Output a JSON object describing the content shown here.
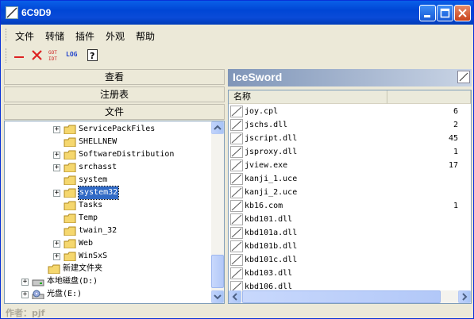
{
  "window": {
    "title": "6C9D9"
  },
  "menu": [
    "文件",
    "转储",
    "插件",
    "外观",
    "帮助"
  ],
  "toolbar": {
    "log_label": "LOG"
  },
  "nav": {
    "view": "查看",
    "registry": "注册表",
    "files": "文件"
  },
  "tree": {
    "items": [
      {
        "label": "ServicePackFiles",
        "expander": "+"
      },
      {
        "label": "SHELLNEW",
        "expander": ""
      },
      {
        "label": "SoftwareDistribution",
        "expander": "+"
      },
      {
        "label": "srchasst",
        "expander": "+"
      },
      {
        "label": "system",
        "expander": ""
      },
      {
        "label": "system32",
        "expander": "+",
        "selected": true
      },
      {
        "label": "Tasks",
        "expander": ""
      },
      {
        "label": "Temp",
        "expander": ""
      },
      {
        "label": "twain_32",
        "expander": ""
      },
      {
        "label": "Web",
        "expander": "+"
      },
      {
        "label": "WinSxS",
        "expander": "+"
      },
      {
        "label": "新建文件夹",
        "expander": ""
      },
      {
        "label": "本地磁盘(D:)",
        "expander": "+"
      },
      {
        "label": "光盘(E:)",
        "expander": "+"
      }
    ]
  },
  "panel": {
    "title": "IceSword"
  },
  "list": {
    "column_name": "名称",
    "files": [
      {
        "name": "joy.cpl",
        "size": "6"
      },
      {
        "name": "jschs.dll",
        "size": "2"
      },
      {
        "name": "jscript.dll",
        "size": "45"
      },
      {
        "name": "jsproxy.dll",
        "size": "1"
      },
      {
        "name": "jview.exe",
        "size": "17"
      },
      {
        "name": "kanji_1.uce",
        "size": ""
      },
      {
        "name": "kanji_2.uce",
        "size": ""
      },
      {
        "name": "kb16.com",
        "size": "1"
      },
      {
        "name": "kbd101.dll",
        "size": ""
      },
      {
        "name": "kbd101a.dll",
        "size": ""
      },
      {
        "name": "kbd101b.dll",
        "size": ""
      },
      {
        "name": "kbd101c.dll",
        "size": ""
      },
      {
        "name": "kbd103.dll",
        "size": ""
      },
      {
        "name": "kbd106.dll",
        "size": ""
      }
    ]
  },
  "status": {
    "author": "作者：pjf"
  },
  "colors": {
    "selection": "#316ac5",
    "title_bar": "#0a5fe8"
  }
}
